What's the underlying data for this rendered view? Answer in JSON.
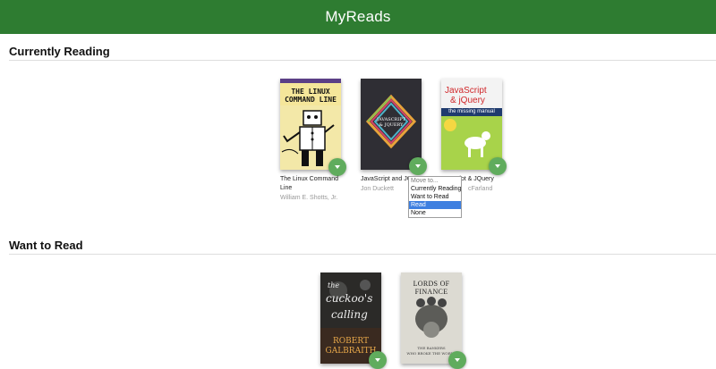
{
  "app": {
    "title": "MyReads"
  },
  "shelves": [
    {
      "title": "Currently Reading",
      "books": [
        {
          "title": "The Linux Command Line",
          "author": "William E. Shotts, Jr.",
          "cover_lines": [
            "THE LINUX",
            "COMMAND LINE"
          ]
        },
        {
          "title": "JavaScript and JQ",
          "author": "Jon Duckett",
          "cover_lines": [
            "JAVASCRIPT",
            "& JQUERY"
          ]
        },
        {
          "title": "ript & JQuery",
          "author": "cFarland",
          "cover_lines": [
            "JavaScript",
            "& jQuery",
            "the missing manual"
          ]
        }
      ]
    },
    {
      "title": "Want to Read",
      "books": [
        {
          "title": "",
          "author": "",
          "cover_lines": [
            "the",
            "cuckoo's",
            "calling",
            "ROBERT",
            "GALBRAITH"
          ]
        },
        {
          "title": "",
          "author": "",
          "cover_lines": [
            "LORDS OF FINANCE",
            "THE BANKERS",
            "WHO BROKE THE WORLD"
          ]
        }
      ]
    }
  ],
  "move_menu": {
    "options": [
      "Move to...",
      "Currently Reading",
      "Want to Read",
      "Read",
      "None"
    ],
    "selected": "Read"
  },
  "colors": {
    "header": "#2e7c31",
    "changer": "#60ac5d",
    "selected_option": "#3e7fe0"
  }
}
